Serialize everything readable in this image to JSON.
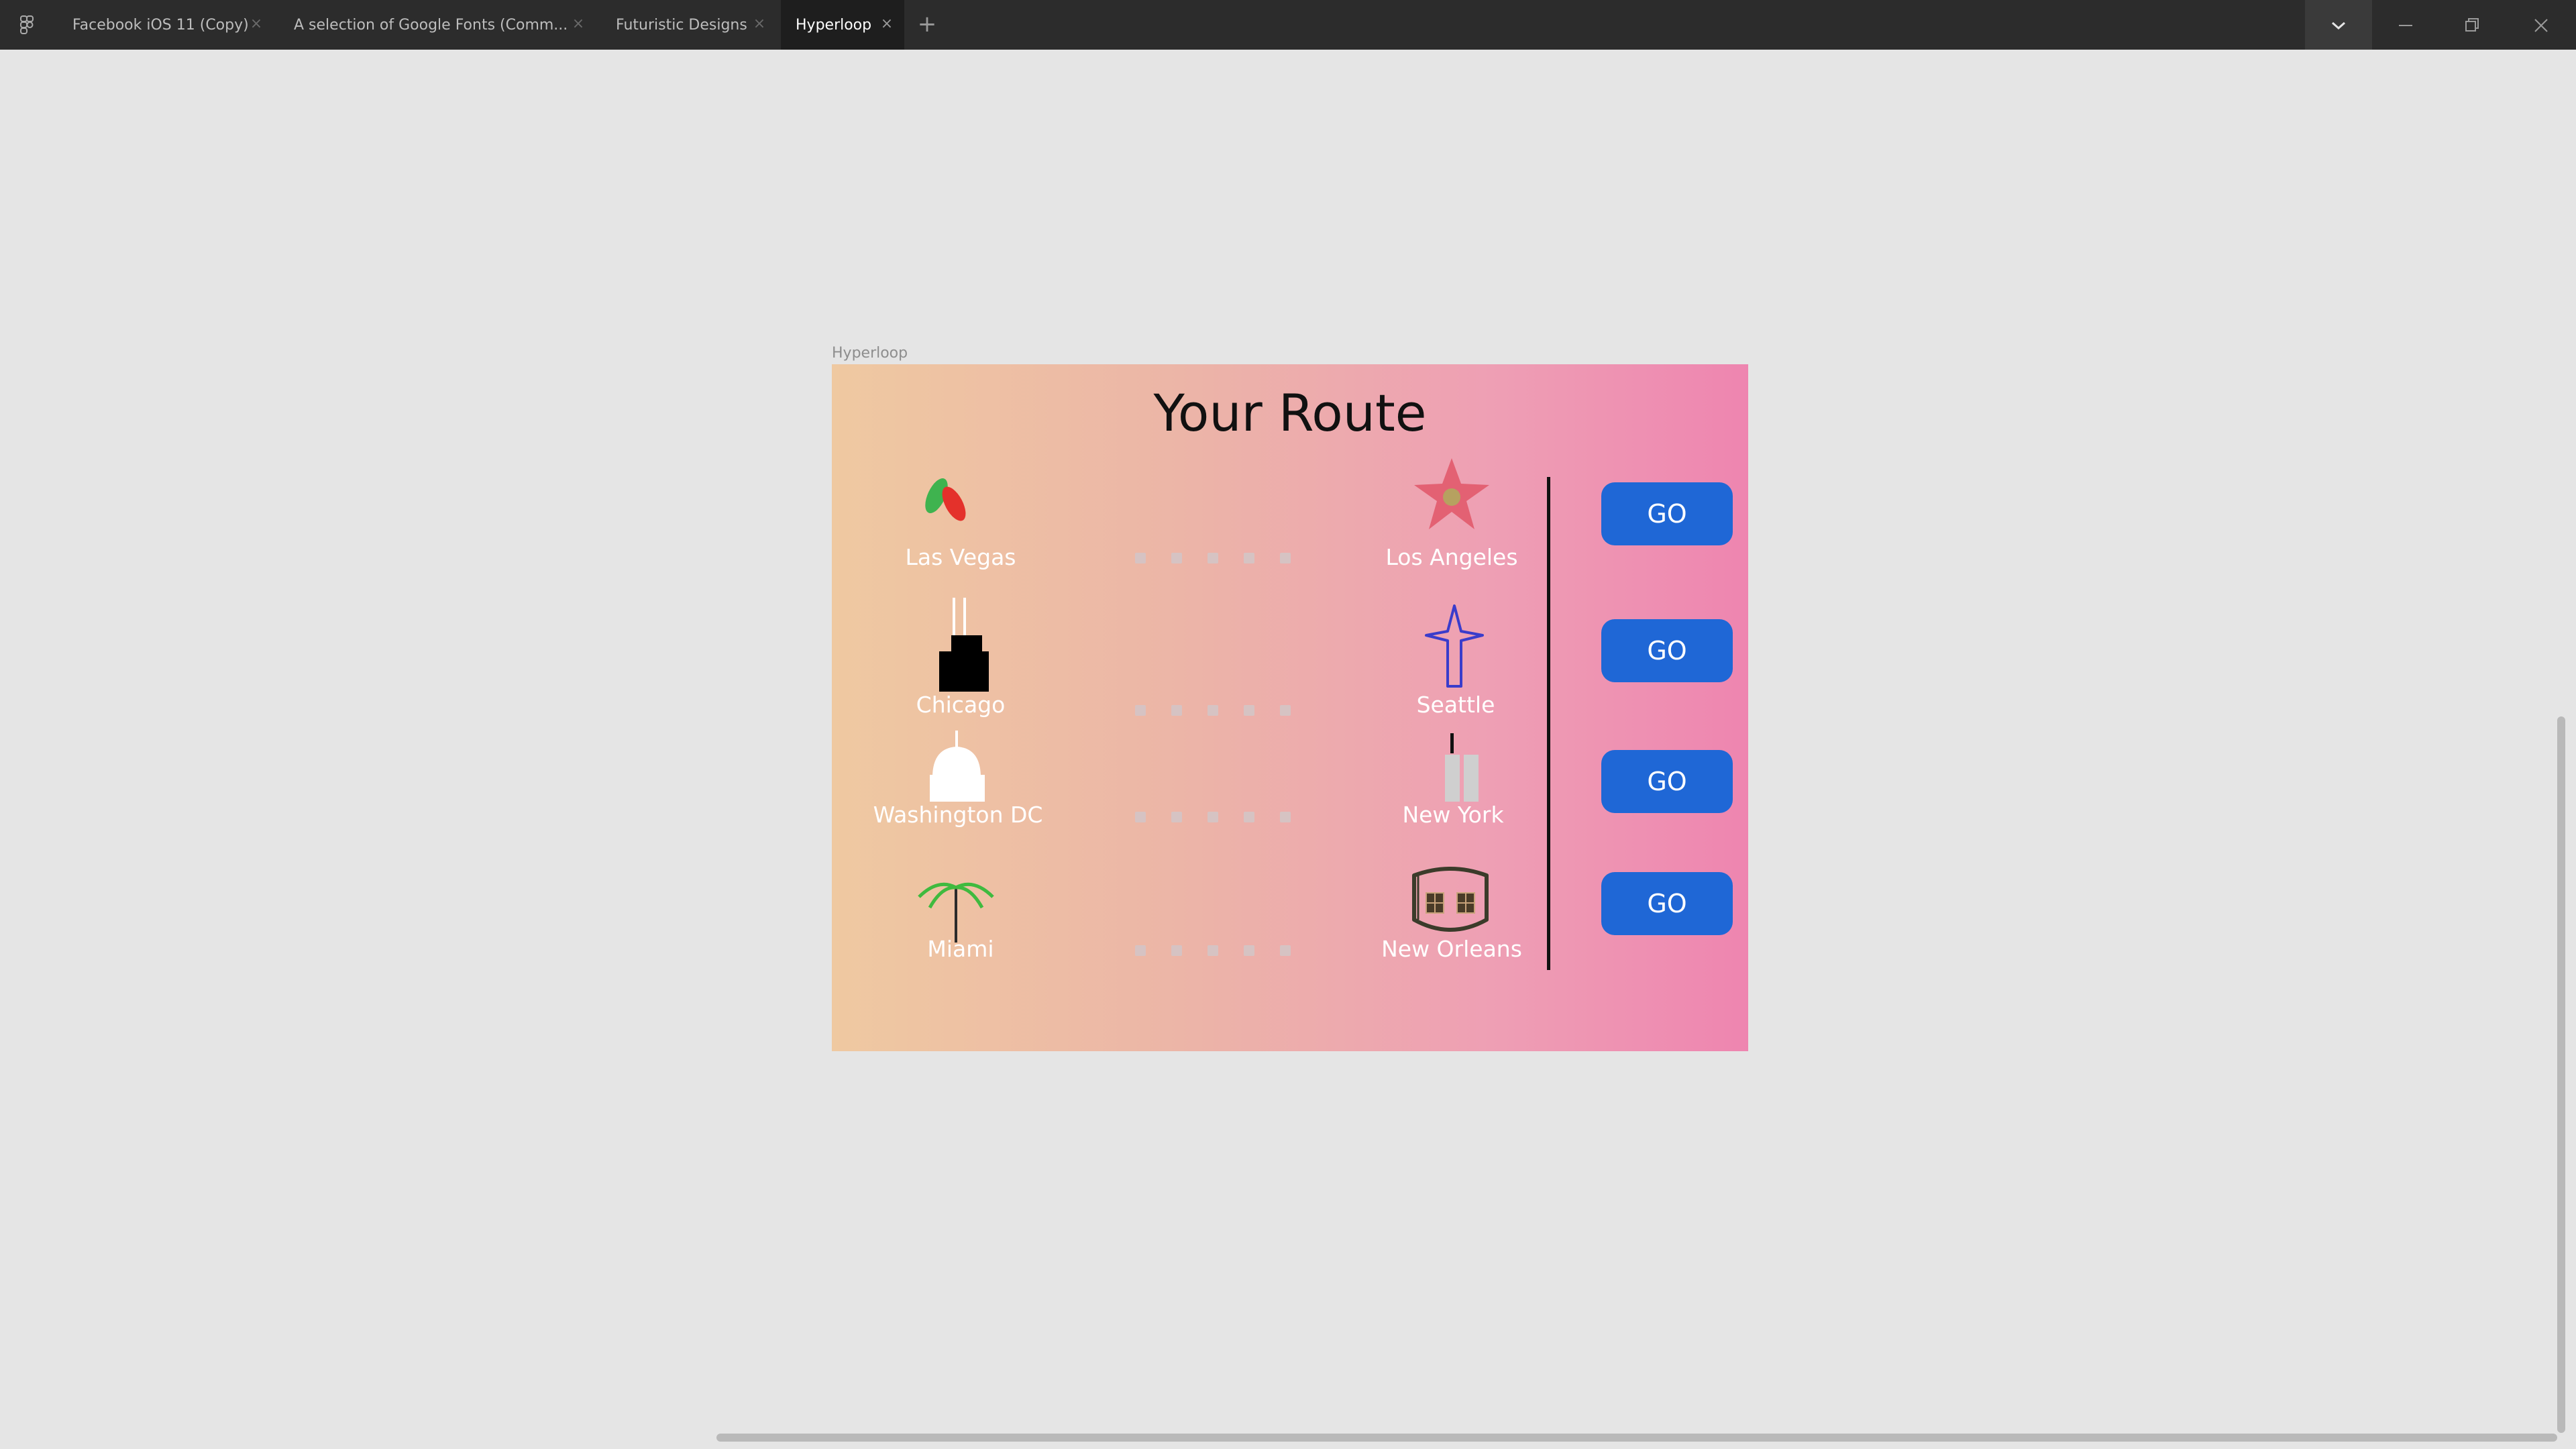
{
  "tabs": [
    {
      "label": "Facebook iOS 11 (Copy)"
    },
    {
      "label": "A selection of Google Fonts (Comm..."
    },
    {
      "label": "Futuristic Designs"
    },
    {
      "label": "Hyperloop"
    }
  ],
  "frame": {
    "label": "Hyperloop",
    "title": "Your Route"
  },
  "routes": [
    {
      "from": "Las Vegas",
      "to": "Los Angeles",
      "button": "GO"
    },
    {
      "from": "Chicago",
      "to": "Seattle",
      "button": "GO"
    },
    {
      "from": "Washington DC",
      "to": "New York",
      "button": "GO"
    },
    {
      "from": "Miami",
      "to": "New Orleans",
      "button": "GO"
    }
  ],
  "icons": {
    "las_vegas": "dice-icon",
    "los_angeles": "star-icon",
    "chicago": "tower-icon",
    "seattle": "space-needle-icon",
    "washington_dc": "capitol-icon",
    "new_york": "twin-towers-icon",
    "miami": "palm-tree-icon",
    "new_orleans": "building-icon"
  },
  "colors": {
    "button": "#1f67d6",
    "titlebar": "#2c2c2c",
    "canvas": "#e5e5e5"
  }
}
